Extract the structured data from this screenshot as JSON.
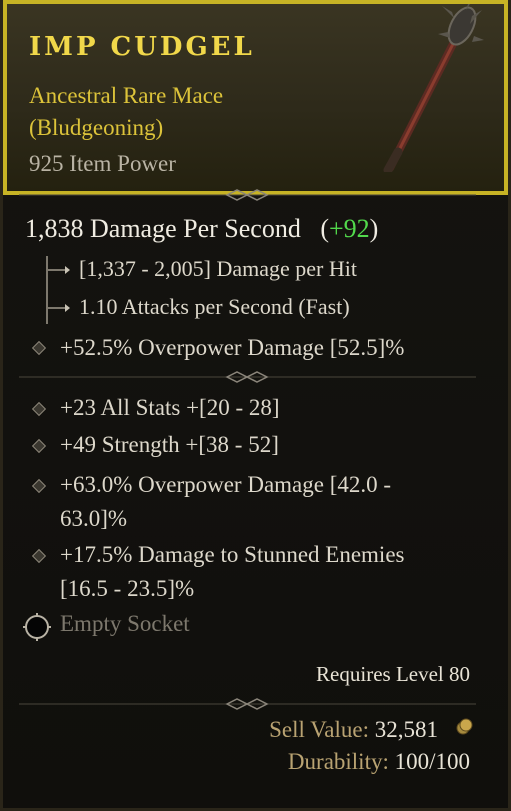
{
  "item": {
    "name": "IMP CUDGEL",
    "subtitle": "Ancestral Rare Mace (Bludgeoning)",
    "item_power": "925 Item Power",
    "dps_value": "1,838 Damage Per Second",
    "dps_delta_open": "(",
    "dps_delta": "+92",
    "dps_delta_close": ")",
    "damage_per_hit": "[1,337 - 2,005] Damage per Hit",
    "attack_speed": "1.10 Attacks per Second (Fast)",
    "implicit": "+52.5% Overpower Damage [52.5]%",
    "affixes": [
      "+23 All Stats +[20 - 28]",
      "+49 Strength +[38 - 52]",
      "+63.0% Overpower Damage [42.0 - 63.0]%",
      "+17.5% Damage to Stunned Enemies [16.5 - 23.5]%"
    ],
    "affix_lines": [
      [
        "+23 All Stats +[20 - 28]"
      ],
      [
        "+49 Strength +[38 - 52]"
      ],
      [
        "+63.0% Overpower Damage [42.0 -",
        "63.0]%"
      ],
      [
        "+17.5% Damage to Stunned Enemies",
        "[16.5 - 23.5]%"
      ]
    ],
    "socket": "Empty Socket",
    "requires": "Requires Level 80",
    "sell_label": "Sell Value:",
    "sell_value": "32,581",
    "durability_label": "Durability:",
    "durability_value": "100/100"
  },
  "colors": {
    "border": "#c7b325",
    "name": "#f1d84a",
    "subtitle": "#dcc33a",
    "dps_delta": "#52d94c"
  },
  "icons": [
    "mace-icon",
    "socket-icon",
    "gold-coin-icon",
    "bullet-diamond-icon"
  ]
}
